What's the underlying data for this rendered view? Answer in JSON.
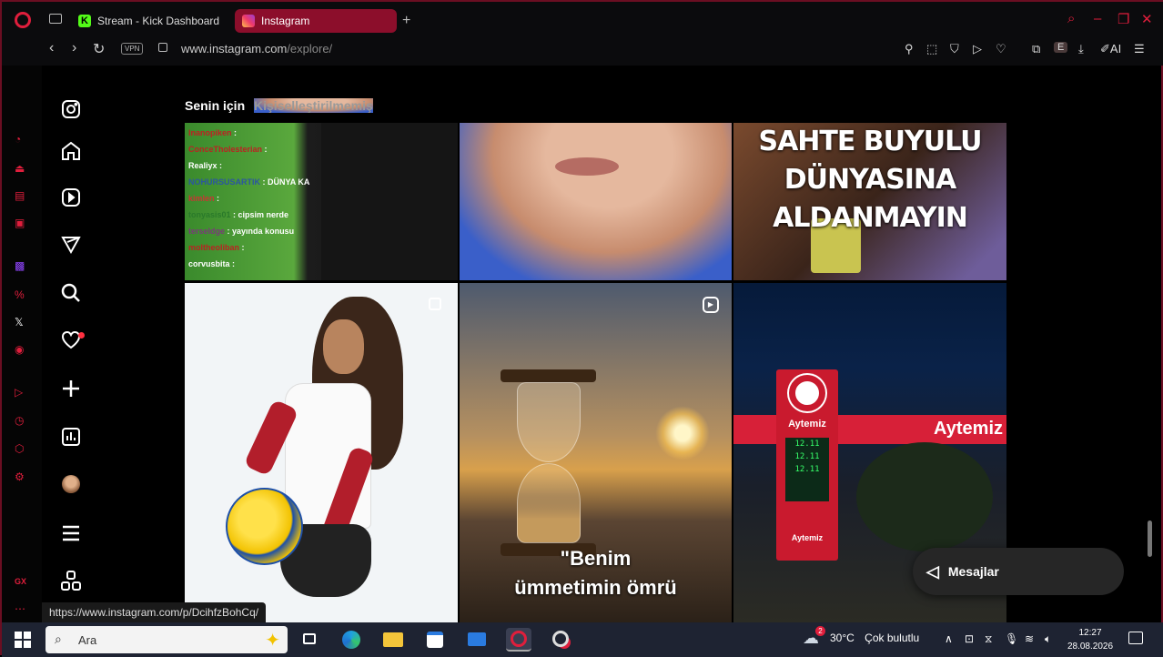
{
  "browser": {
    "tabs": [
      {
        "label": "Stream - Kick Dashboard",
        "favicon": "kick-icon",
        "favicon_letter": "K",
        "active": false
      },
      {
        "label": "Instagram",
        "favicon": "instagram-icon",
        "active": true
      }
    ],
    "new_tab": "+",
    "vpn_label": "VPN",
    "url_domain": "www.instagram.com",
    "url_path": "/explore/",
    "toolbar_ai": "AI",
    "profile_letter": "E",
    "accent": "#e01e3c"
  },
  "instagram": {
    "feed_tabs": {
      "for_you": "Senin için",
      "unpersonalized": "Kişiselleştirilmemiş"
    },
    "sidebar_icons": [
      "instagram-logo-icon",
      "home-icon",
      "reels-icon",
      "explore-icon",
      "search-icon",
      "notifications-icon",
      "create-icon",
      "dashboard-icon",
      "profile-avatar",
      "menu-icon",
      "also-from-meta-icon"
    ],
    "posts": {
      "p1": {
        "chat_lines": [
          {
            "user": "lnanopiken",
            "msg": ":"
          },
          {
            "user": "ConceTholesterian",
            "msg": ":"
          },
          {
            "user": "Realiyx",
            "msg": ":"
          },
          {
            "user": "NOHURSUSARTIK",
            "msg": ": DÜNYA KA"
          },
          {
            "user": "kimlen",
            "msg": ":"
          },
          {
            "user": "tonyasis01",
            "msg": ": cipsim nerde"
          },
          {
            "user": "terseldge",
            "msg": ": yayında konusu"
          },
          {
            "user": "moltheoliban",
            "msg": ":"
          },
          {
            "user": "corvusbita",
            "msg": ":"
          }
        ]
      },
      "p3": {
        "caption": [
          "SAHTE BUYULU",
          "DÜNYASINA",
          "ALDANMAYIN"
        ]
      },
      "p5": {
        "caption": [
          "\"Benim",
          "ümmetimin ömrü"
        ]
      },
      "p6": {
        "sign_brand": "Aytemiz",
        "canopy_brand": "Aytemiz",
        "prices": [
          "12.11",
          "12.11",
          "12.11"
        ],
        "sign_footer": "Aytemiz"
      }
    },
    "messages_label": "Mesajlar"
  },
  "status_url": "https://www.instagram.com/p/DcihfzBohCq/",
  "taskbar": {
    "search_placeholder": "Ara",
    "weather_temp": "30°C",
    "weather_cond": "Çok bulutlu",
    "time": "12:27",
    "date": "28.08.2026",
    "weather_badge": "2"
  }
}
